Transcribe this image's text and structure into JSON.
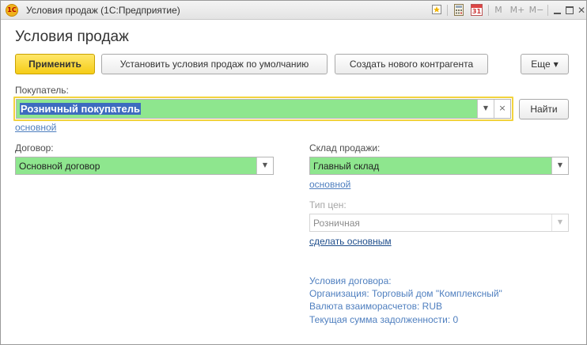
{
  "window": {
    "title": "Условия продаж  (1С:Предприятие)",
    "logo_text": "1С",
    "toolbar_icons": [
      "bookmark-icon",
      "calculator-icon",
      "calendar-icon",
      "memory-m-icon",
      "memory-mplus-icon",
      "memory-mminus-icon",
      "minimize-icon",
      "maximize-icon",
      "close-icon"
    ],
    "toolbar_labels": {
      "calendar": "31",
      "m": "M",
      "mplus": "M+",
      "mminus": "M−",
      "close": "✕"
    }
  },
  "form": {
    "title": "Условия продаж",
    "buttons": {
      "apply": "Применить",
      "set_default": "Установить условия продаж по умолчанию",
      "create_counterparty": "Создать нового контрагента",
      "more": "Еще",
      "find": "Найти"
    },
    "buyer": {
      "label": "Покупатель:",
      "value": "Розничный покупатель",
      "link": "основной"
    },
    "contract": {
      "label": "Договор:",
      "value": "Основной договор"
    },
    "warehouse": {
      "label": "Склад продажи:",
      "value": "Главный склад",
      "link": "основной"
    },
    "price_type": {
      "label": "Тип цен:",
      "value": "Розничная",
      "link": "сделать основным"
    },
    "contract_info": {
      "heading": "Условия договора:",
      "organization": "Организация: Торговый дом \"Комплексный\"",
      "currency": "Валюта взаиморасчетов: RUB",
      "debt": "Текущая сумма задолженности: 0"
    }
  },
  "colors": {
    "field_fill": "#8ee68e",
    "primary_button": "#f5cc16",
    "focus_ring": "#f2d33d",
    "link": "#4f7fbf",
    "selection": "#3d6bbf"
  }
}
